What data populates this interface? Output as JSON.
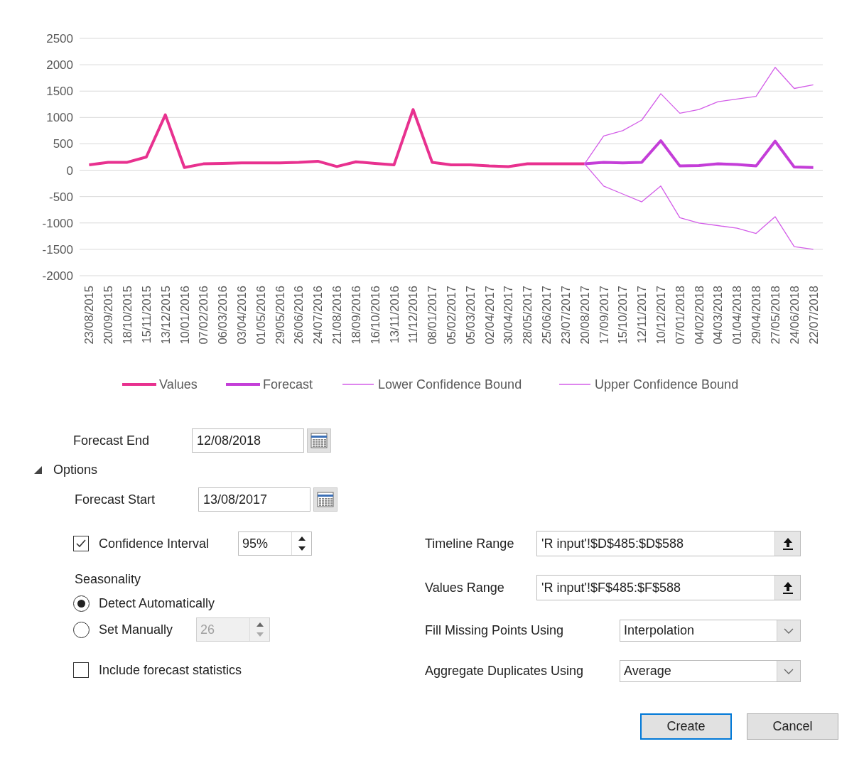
{
  "chart": {
    "chart_data": {
      "type": "line",
      "categories": [
        "23/08/2015",
        "20/09/2015",
        "18/10/2015",
        "15/11/2015",
        "13/12/2015",
        "10/01/2016",
        "07/02/2016",
        "06/03/2016",
        "03/04/2016",
        "01/05/2016",
        "29/05/2016",
        "26/06/2016",
        "24/07/2016",
        "21/08/2016",
        "18/09/2016",
        "16/10/2016",
        "13/11/2016",
        "11/12/2016",
        "08/01/2017",
        "05/02/2017",
        "05/03/2017",
        "02/04/2017",
        "30/04/2017",
        "28/05/2017",
        "25/06/2017",
        "23/07/2017",
        "20/08/2017",
        "17/09/2017",
        "15/10/2017",
        "12/11/2017",
        "10/12/2017",
        "07/01/2018",
        "04/02/2018",
        "04/03/2018",
        "01/04/2018",
        "29/04/2018",
        "27/05/2018",
        "24/06/2018",
        "22/07/2018"
      ],
      "series": [
        {
          "name": "Values",
          "color": "#e8318f",
          "values": [
            100,
            150,
            150,
            250,
            1050,
            50,
            120,
            130,
            140,
            140,
            140,
            150,
            170,
            70,
            160,
            130,
            100,
            1150,
            150,
            100,
            100,
            80,
            70,
            120,
            120,
            120,
            120,
            null,
            null,
            null,
            null,
            null,
            null,
            null,
            null,
            null,
            null,
            null,
            null
          ]
        },
        {
          "name": "Forecast",
          "color": "#c43ed8",
          "values": [
            null,
            null,
            null,
            null,
            null,
            null,
            null,
            null,
            null,
            null,
            null,
            null,
            null,
            null,
            null,
            null,
            null,
            null,
            null,
            null,
            null,
            null,
            null,
            null,
            null,
            null,
            120,
            150,
            140,
            150,
            560,
            80,
            90,
            120,
            110,
            80,
            550,
            60,
            50
          ]
        },
        {
          "name": "Lower Confidence Bound",
          "color": "#d35ee8",
          "values": [
            null,
            null,
            null,
            null,
            null,
            null,
            null,
            null,
            null,
            null,
            null,
            null,
            null,
            null,
            null,
            null,
            null,
            null,
            null,
            null,
            null,
            null,
            null,
            null,
            null,
            null,
            120,
            -300,
            -450,
            -600,
            -300,
            -900,
            -1000,
            -1050,
            -1100,
            -1200,
            -880,
            -1450,
            -1500
          ]
        },
        {
          "name": "Upper Confidence Bound",
          "color": "#d35ee8",
          "values": [
            null,
            null,
            null,
            null,
            null,
            null,
            null,
            null,
            null,
            null,
            null,
            null,
            null,
            null,
            null,
            null,
            null,
            null,
            null,
            null,
            null,
            null,
            null,
            null,
            null,
            null,
            120,
            650,
            750,
            950,
            1450,
            1080,
            1150,
            1300,
            1350,
            1400,
            1950,
            1550,
            1620
          ]
        }
      ],
      "grid": true,
      "legend": true,
      "ylim": [
        -2000,
        2500
      ],
      "yticks": [
        -2000,
        -1500,
        -1000,
        -500,
        0,
        500,
        1000,
        1500,
        2000,
        2500
      ]
    }
  },
  "forecast_end": {
    "label": "Forecast End",
    "value": "12/08/2018"
  },
  "options": {
    "label": "Options",
    "expanded": true,
    "forecast_start": {
      "label": "Forecast Start",
      "value": "13/08/2017"
    },
    "confidence_interval": {
      "label": "Confidence Interval",
      "checked": true,
      "value": "95%"
    },
    "seasonality": {
      "label": "Seasonality",
      "choices": [
        {
          "label": "Detect Automatically",
          "selected": true
        },
        {
          "label": "Set Manually",
          "selected": false,
          "value": "26",
          "disabled": true
        }
      ]
    },
    "include_statistics": {
      "label": "Include forecast statistics",
      "checked": false
    },
    "ranges": [
      {
        "label": "Timeline Range",
        "value": "'R input'!$D$485:$D$588"
      },
      {
        "label": "Values Range",
        "value": "'R input'!$F$485:$F$588"
      }
    ],
    "dropdowns": [
      {
        "label": "Fill Missing Points Using",
        "value": "Interpolation"
      },
      {
        "label": "Aggregate Duplicates Using",
        "value": "Average"
      }
    ]
  },
  "buttons": [
    {
      "label": "Create",
      "default": true
    },
    {
      "label": "Cancel",
      "default": false
    }
  ]
}
